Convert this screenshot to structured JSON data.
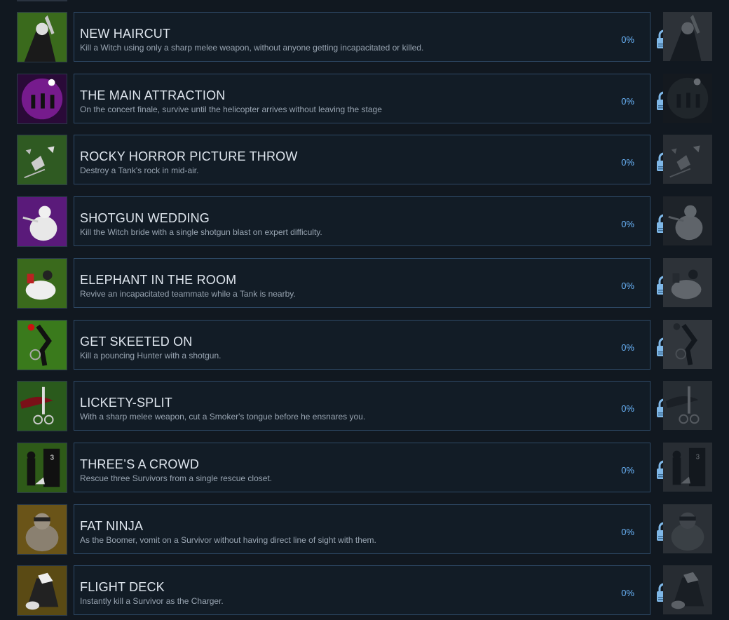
{
  "achievements": [
    {
      "title": "NEW HAIRCUT",
      "description": "Kill a Witch using only a sharp melee weapon, without anyone getting incapacitated or killed.",
      "progress": "0%",
      "icon": "witch-knife-icon",
      "color": "#3a6a1c"
    },
    {
      "title": "THE MAIN ATTRACTION",
      "description": "On the concert finale, survive until the helicopter arrives without leaving the stage",
      "progress": "0%",
      "icon": "concert-stage-icon",
      "color": "#8a1fa3"
    },
    {
      "title": "ROCKY HORROR PICTURE THROW",
      "description": "Destroy a Tank's rock in mid-air.",
      "progress": "0%",
      "icon": "rock-shatter-icon",
      "color": "#2f5a22"
    },
    {
      "title": "SHOTGUN WEDDING",
      "description": "Kill the Witch bride with a single shotgun blast on expert difficulty.",
      "progress": "0%",
      "icon": "witch-bride-icon",
      "color": "#5a1a7a"
    },
    {
      "title": "ELEPHANT IN THE ROOM",
      "description": "Revive an incapacitated teammate while a Tank is nearby.",
      "progress": "0%",
      "icon": "tank-revive-icon",
      "color": "#3a6a1c"
    },
    {
      "title": "GET SKEETED ON",
      "description": "Kill a pouncing Hunter with a shotgun.",
      "progress": "0%",
      "icon": "hunter-pounce-icon",
      "color": "#3a7a1c"
    },
    {
      "title": "LICKETY-SPLIT",
      "description": "With a sharp melee weapon, cut a Smoker's tongue before he ensnares you.",
      "progress": "0%",
      "icon": "scissors-tongue-icon",
      "color": "#2a5a1c"
    },
    {
      "title": "THREE’S A CROWD",
      "description": "Rescue three Survivors from a single rescue closet.",
      "progress": "0%",
      "icon": "rescue-closet-icon",
      "color": "#2e5a18"
    },
    {
      "title": "FAT NINJA",
      "description": "As the Boomer, vomit on a Survivor without having direct line of sight with them.",
      "progress": "0%",
      "icon": "boomer-ninja-icon",
      "color": "#6a5418"
    },
    {
      "title": "FLIGHT DECK",
      "description": "Instantly kill a Survivor as the Charger.",
      "progress": "0%",
      "icon": "charger-icon",
      "color": "#5a4a14"
    }
  ],
  "lock_icon": "padlock-icon",
  "lock_color": "#7fb8e8"
}
